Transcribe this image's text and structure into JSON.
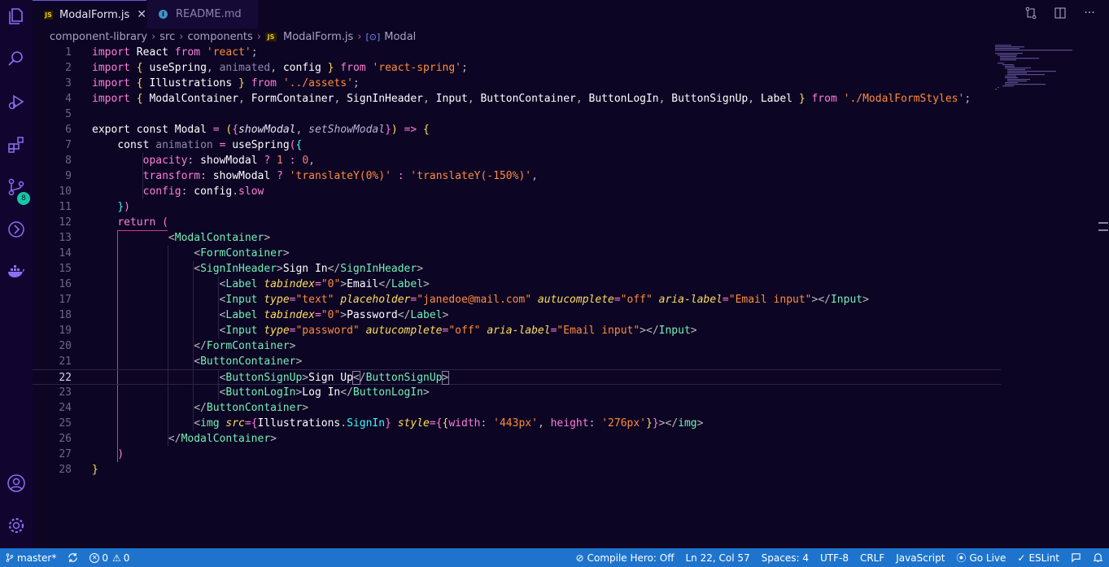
{
  "tabs": [
    {
      "label": "ModalForm.js",
      "icon": "js-icon",
      "active": true,
      "close": "✕"
    },
    {
      "label": "README.md",
      "icon": "info-icon",
      "active": false
    }
  ],
  "breadcrumb": [
    "component-library",
    "src",
    "components",
    "ModalForm.js",
    "Modal"
  ],
  "activity": {
    "scm_badge": "8"
  },
  "editor": {
    "current_line": 22,
    "lines": [
      "1",
      "2",
      "3",
      "4",
      "5",
      "6",
      "7",
      "8",
      "9",
      "10",
      "11",
      "12",
      "13",
      "14",
      "15",
      "16",
      "17",
      "18",
      "19",
      "20",
      "21",
      "22",
      "23",
      "24",
      "25",
      "26",
      "27",
      "28"
    ]
  },
  "status": {
    "branch": "master*",
    "errors": "0",
    "warnings": "0",
    "compile_hero": "Compile Hero: Off",
    "cursor": "Ln 22, Col 57",
    "spaces": "Spaces: 4",
    "encoding": "UTF-8",
    "eol": "CRLF",
    "language": "JavaScript",
    "go_live": "Go Live",
    "eslint": "ESLint"
  },
  "colors": {
    "statusbar": "#1e74cc",
    "background": "#0d0524",
    "keyword": "#ff7edb",
    "string": "#ff8b39",
    "tag": "#72f1b8",
    "attribute": "#fede5d",
    "function": "#36f9f6"
  }
}
